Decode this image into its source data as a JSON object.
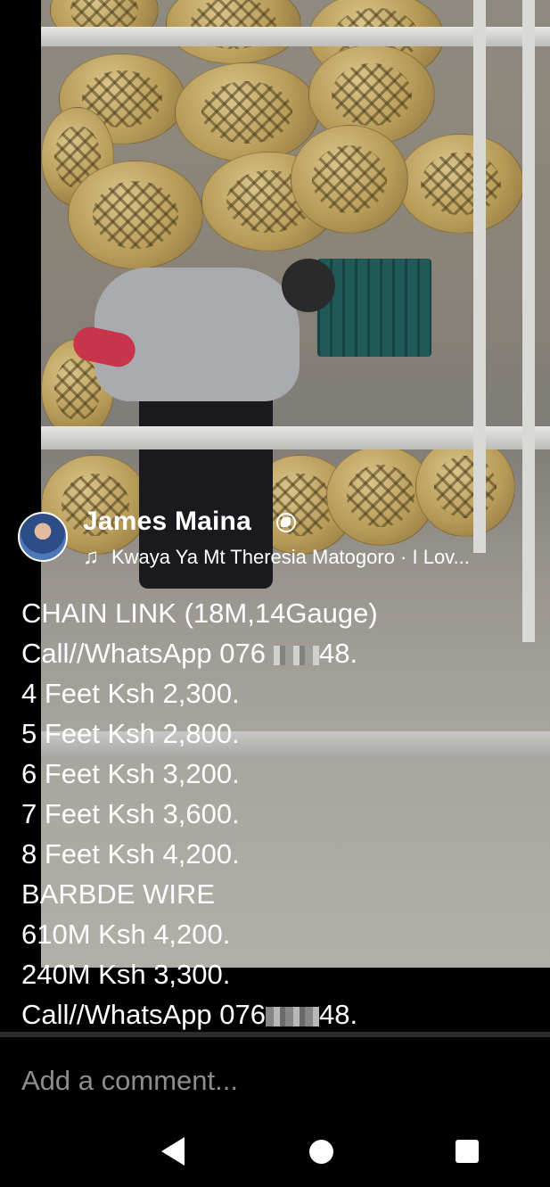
{
  "post": {
    "author_name": "James Maina",
    "privacy_icon": "globe-icon",
    "music_icon": "music-note-icon",
    "music_title": "Kwaya Ya Mt Theresia Matogoro · I Lov..."
  },
  "caption": {
    "lines": [
      "CHAIN LINK (18M,14Gauge)",
      "Call//WhatsApp 076",
      "4 Feet Ksh 2,300.",
      "5 Feet Ksh 2,800.",
      "6 Feet Ksh 3,200.",
      "7 Feet Ksh 3,600.",
      "8 Feet Ksh 4,200.",
      "BARBDE WIRE",
      "610M Ksh 4,200.",
      "240M Ksh 3,300.",
      "Call//WhatsApp 076"
    ],
    "phone_suffix": "48."
  },
  "comment": {
    "placeholder": "Add a comment..."
  },
  "navbar": {
    "back_icon": "back-triangle-icon",
    "home_icon": "home-circle-icon",
    "recents_icon": "recents-square-icon"
  }
}
